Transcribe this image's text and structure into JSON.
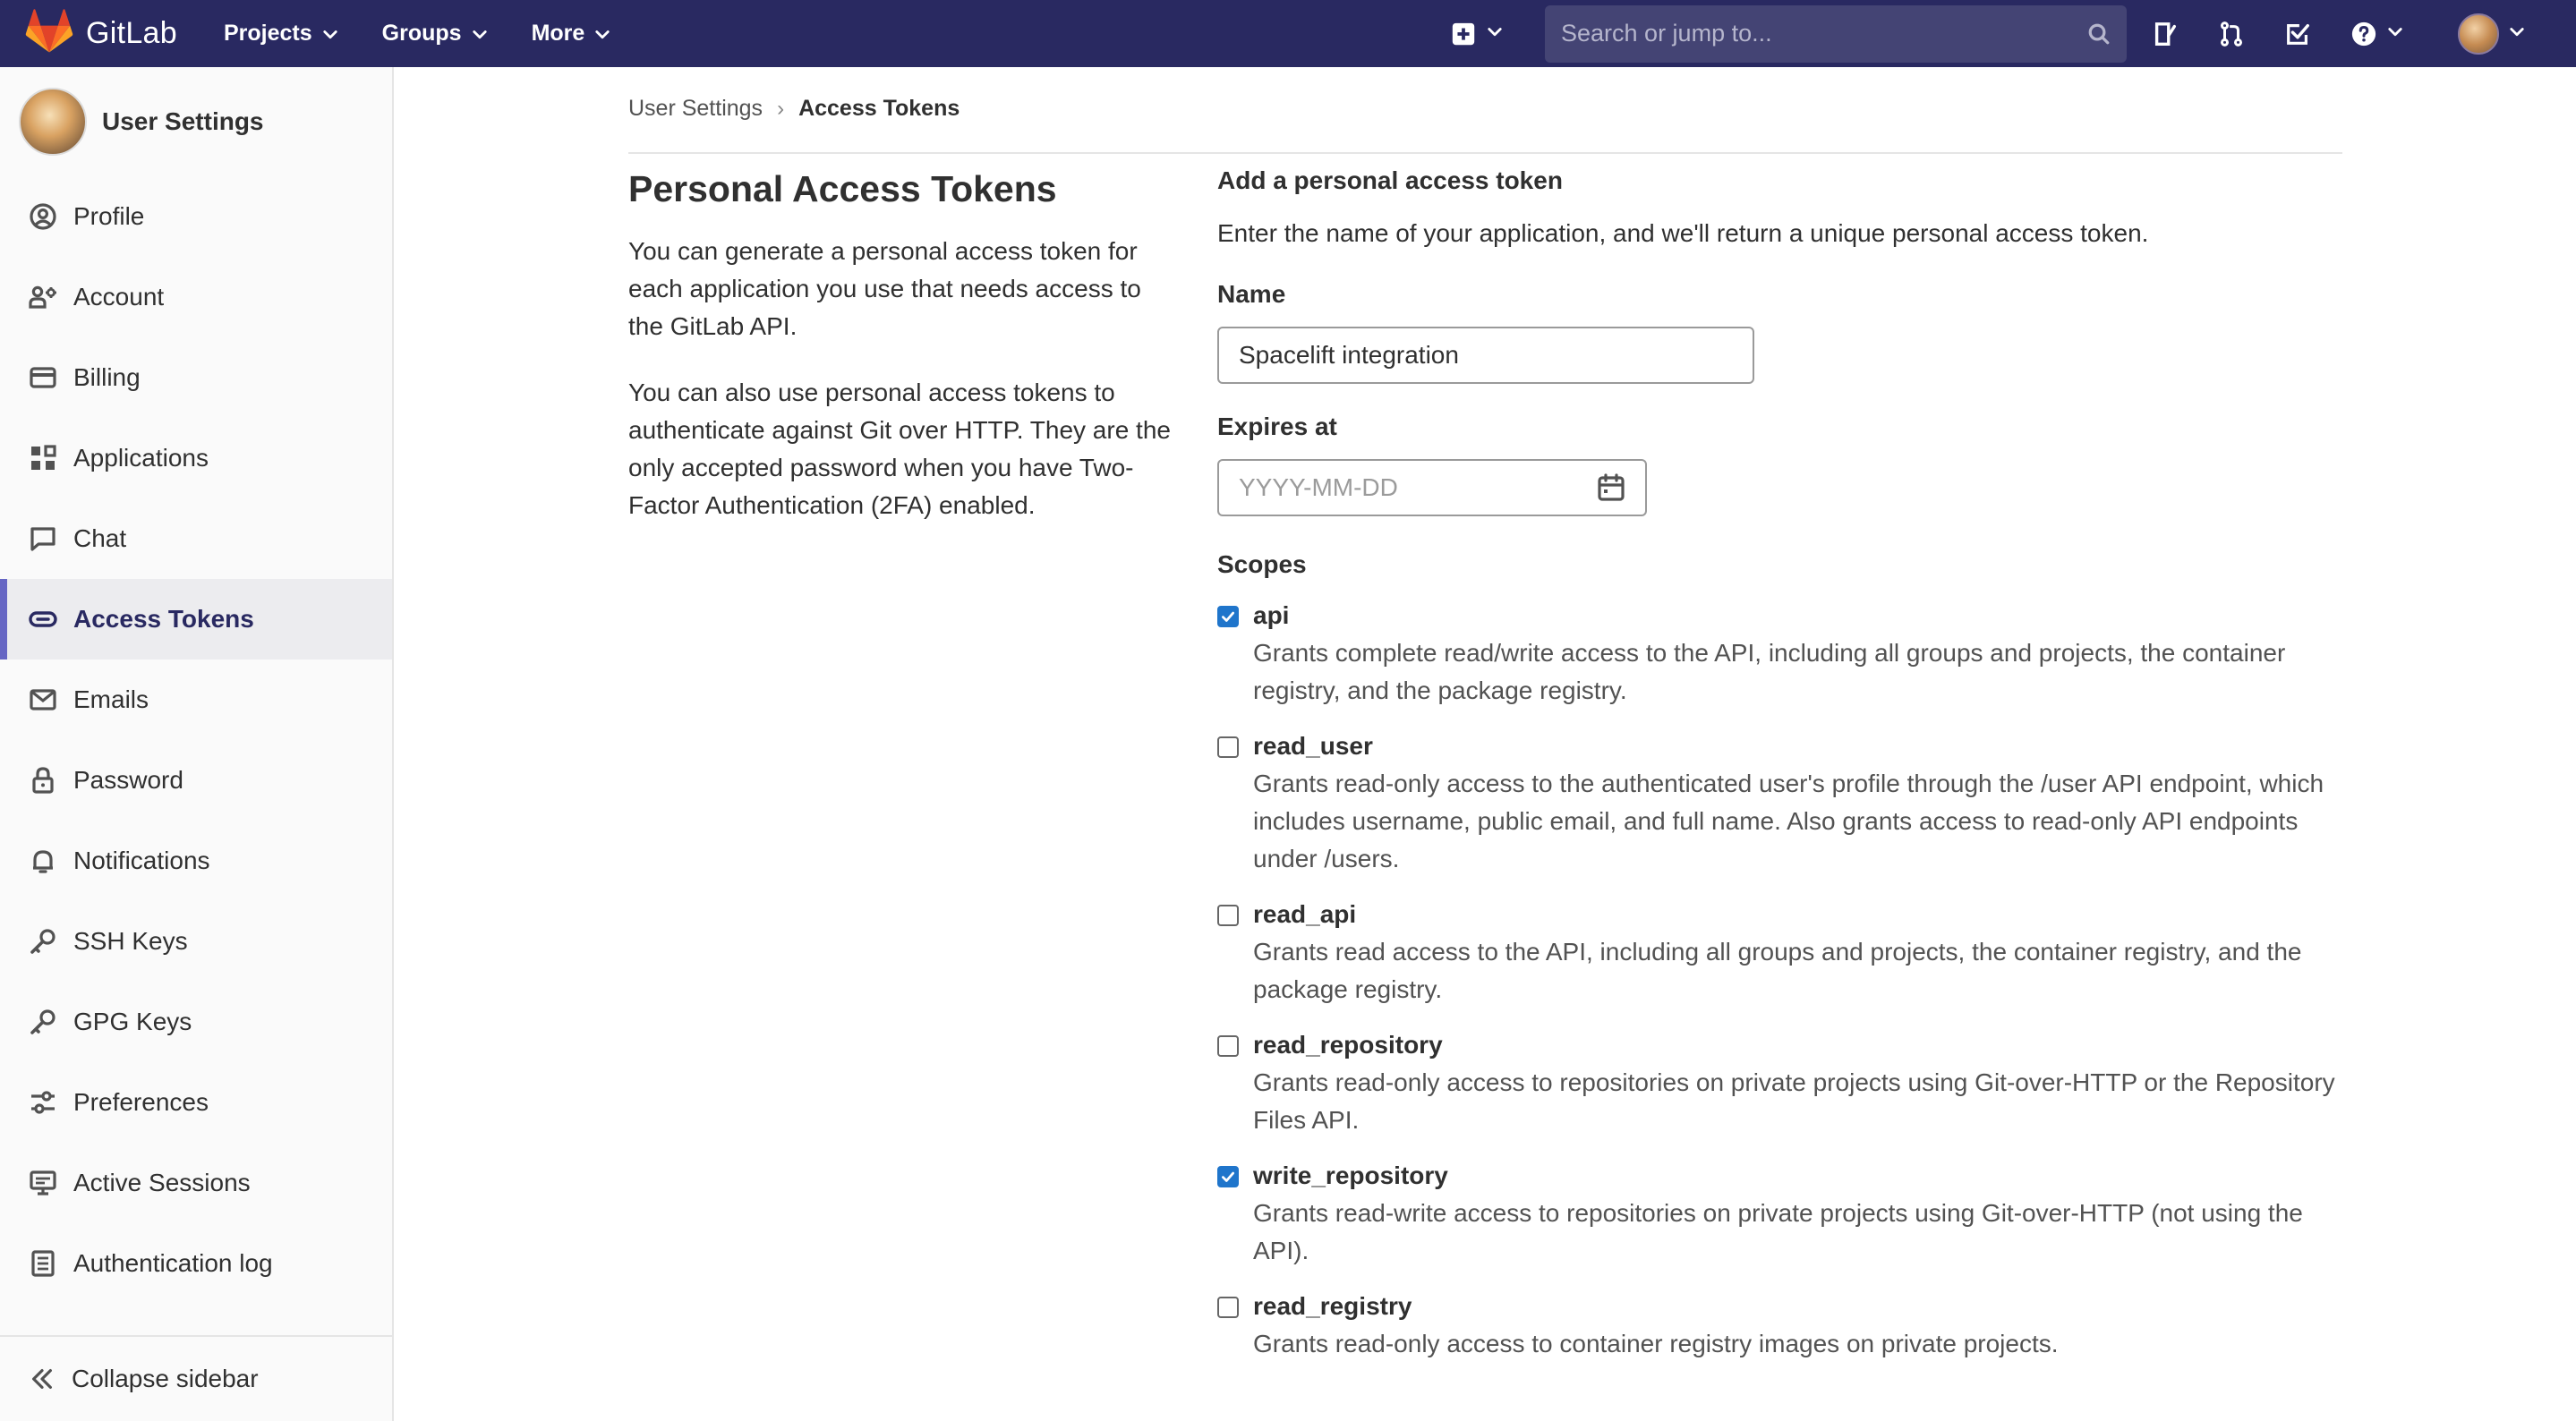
{
  "navbar": {
    "brand": "GitLab",
    "menu": [
      {
        "label": "Projects"
      },
      {
        "label": "Groups"
      },
      {
        "label": "More"
      }
    ],
    "search_placeholder": "Search or jump to...",
    "icons": [
      "plus-square-icon",
      "chevron-down-icon",
      "search-icon",
      "issues-icon",
      "merge-request-icon",
      "todo-icon",
      "help-icon",
      "avatar"
    ]
  },
  "sidebar": {
    "title": "User Settings",
    "items": [
      {
        "label": "Profile",
        "icon": "profile-icon"
      },
      {
        "label": "Account",
        "icon": "account-icon"
      },
      {
        "label": "Billing",
        "icon": "billing-icon"
      },
      {
        "label": "Applications",
        "icon": "applications-icon"
      },
      {
        "label": "Chat",
        "icon": "chat-icon"
      },
      {
        "label": "Access Tokens",
        "icon": "token-icon",
        "active": true
      },
      {
        "label": "Emails",
        "icon": "mail-icon"
      },
      {
        "label": "Password",
        "icon": "lock-icon"
      },
      {
        "label": "Notifications",
        "icon": "bell-icon"
      },
      {
        "label": "SSH Keys",
        "icon": "key-icon"
      },
      {
        "label": "GPG Keys",
        "icon": "key-icon"
      },
      {
        "label": "Preferences",
        "icon": "preferences-icon"
      },
      {
        "label": "Active Sessions",
        "icon": "monitor-icon"
      },
      {
        "label": "Authentication log",
        "icon": "log-icon"
      }
    ],
    "collapse_label": "Collapse sidebar"
  },
  "breadcrumb": {
    "parent": "User Settings",
    "current": "Access Tokens"
  },
  "intro": {
    "title": "Personal Access Tokens",
    "paragraph1": "You can generate a personal access token for each application you use that needs access to the GitLab API.",
    "paragraph2": "You can also use personal access tokens to authenticate against Git over HTTP. They are the only accepted password when you have Two-Factor Authentication (2FA) enabled."
  },
  "form": {
    "heading": "Add a personal access token",
    "help": "Enter the name of your application, and we'll return a unique personal access token.",
    "name_label": "Name",
    "name_value": "Spacelift integration",
    "expires_label": "Expires at",
    "expires_placeholder": "YYYY-MM-DD",
    "scopes_label": "Scopes",
    "scopes": [
      {
        "name": "api",
        "checked": true,
        "description": "Grants complete read/write access to the API, including all groups and projects, the container registry, and the package registry."
      },
      {
        "name": "read_user",
        "checked": false,
        "description": "Grants read-only access to the authenticated user's profile through the /user API endpoint, which includes username, public email, and full name. Also grants access to read-only API endpoints under /users."
      },
      {
        "name": "read_api",
        "checked": false,
        "description": "Grants read access to the API, including all groups and projects, the container registry, and the package registry."
      },
      {
        "name": "read_repository",
        "checked": false,
        "description": "Grants read-only access to repositories on private projects using Git-over-HTTP or the Repository Files API."
      },
      {
        "name": "write_repository",
        "checked": true,
        "description": "Grants read-write access to repositories on private projects using Git-over-HTTP (not using the API)."
      },
      {
        "name": "read_registry",
        "checked": false,
        "description": "Grants read-only access to container registry images on private projects."
      }
    ]
  },
  "colors": {
    "navbar": "#292961",
    "accent": "#6666c4",
    "checkbox": "#1f75cb"
  }
}
